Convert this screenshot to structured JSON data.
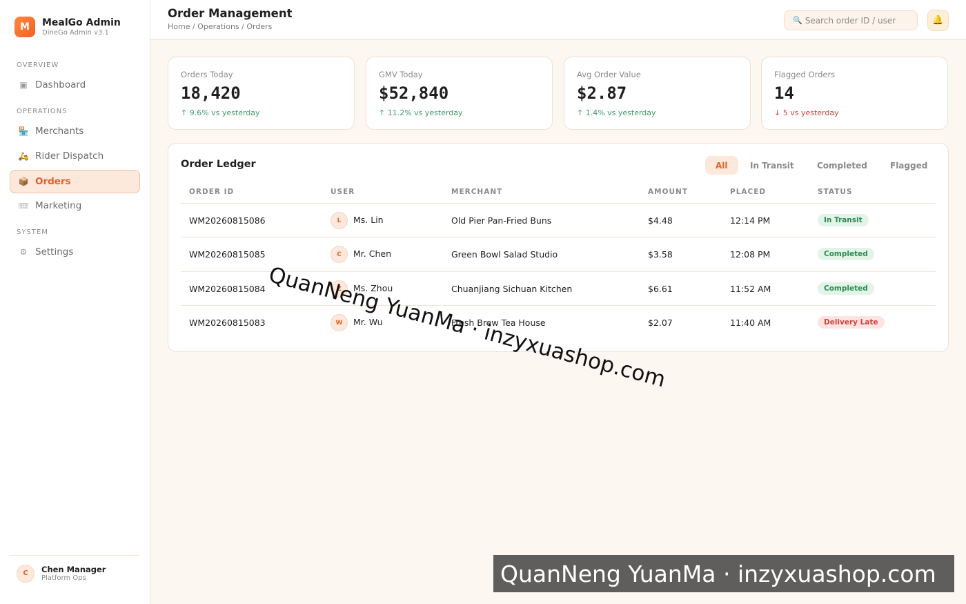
{
  "brand": {
    "logo_letter": "M",
    "name": "MealGo Admin",
    "subtitle": "DineGo Admin v3.1"
  },
  "sidebar": {
    "sections": [
      "OVERVIEW",
      "OPERATIONS",
      "SYSTEM"
    ],
    "items": [
      {
        "label": "Dashboard",
        "icon": "dashboard-icon",
        "glyph": "▣"
      },
      {
        "label": "Merchants",
        "icon": "store-icon",
        "glyph": "🏪"
      },
      {
        "label": "Rider Dispatch",
        "icon": "scooter-icon",
        "glyph": "🛵"
      },
      {
        "label": "Orders",
        "icon": "package-icon",
        "glyph": "📦",
        "active": true
      },
      {
        "label": "Marketing",
        "icon": "ticket-icon",
        "glyph": "🎟"
      },
      {
        "label": "Settings",
        "icon": "gear-icon",
        "glyph": "⚙"
      }
    ]
  },
  "user": {
    "initial": "C",
    "name": "Chen Manager",
    "role": "Platform Ops"
  },
  "header": {
    "title": "Order Management",
    "breadcrumb": "Home / Operations / Orders",
    "search_placeholder": "Search order ID / user",
    "search_icon": "🔍",
    "bell_icon": "🔔"
  },
  "kpis": [
    {
      "label": "Orders Today",
      "value": "18,420",
      "delta": "↑ 9.6% vs yesterday",
      "trend": "up"
    },
    {
      "label": "GMV Today",
      "value": "$52,840",
      "delta": "↑ 11.2% vs yesterday",
      "trend": "up"
    },
    {
      "label": "Avg Order Value",
      "value": "$2.87",
      "delta": "↑ 1.4% vs yesterday",
      "trend": "up"
    },
    {
      "label": "Flagged Orders",
      "value": "14",
      "delta": "↓ 5 vs yesterday",
      "trend": "down"
    }
  ],
  "ledger": {
    "title": "Order Ledger",
    "filters": [
      "All",
      "In Transit",
      "Completed",
      "Flagged"
    ],
    "active_filter": "All",
    "columns": [
      "ORDER ID",
      "USER",
      "MERCHANT",
      "AMOUNT",
      "PLACED",
      "STATUS"
    ],
    "rows": [
      {
        "order_id": "WM20260815086",
        "user_initial": "L",
        "user": "Ms. Lin",
        "merchant": "Old Pier Pan-Fried Buns",
        "amount": "$4.48",
        "placed": "12:14 PM",
        "status": "In Transit",
        "status_type": "transit"
      },
      {
        "order_id": "WM20260815085",
        "user_initial": "C",
        "user": "Mr. Chen",
        "merchant": "Green Bowl Salad Studio",
        "amount": "$3.58",
        "placed": "12:08 PM",
        "status": "Completed",
        "status_type": "done"
      },
      {
        "order_id": "WM20260815084",
        "user_initial": "Z",
        "user": "Ms. Zhou",
        "merchant": "Chuanjiang Sichuan Kitchen",
        "amount": "$6.61",
        "placed": "11:52 AM",
        "status": "Completed",
        "status_type": "done"
      },
      {
        "order_id": "WM20260815083",
        "user_initial": "W",
        "user": "Mr. Wu",
        "merchant": "Fresh Brew Tea House",
        "amount": "$2.07",
        "placed": "11:40 AM",
        "status": "Delivery Late",
        "status_type": "late"
      }
    ]
  },
  "watermark": {
    "text": "QuanNeng YuanMa · inzyxuashop.com"
  },
  "colors": {
    "accent": "#e2622a",
    "success": "#2f8a55",
    "danger": "#d0433c",
    "background": "#fdf7f1"
  }
}
